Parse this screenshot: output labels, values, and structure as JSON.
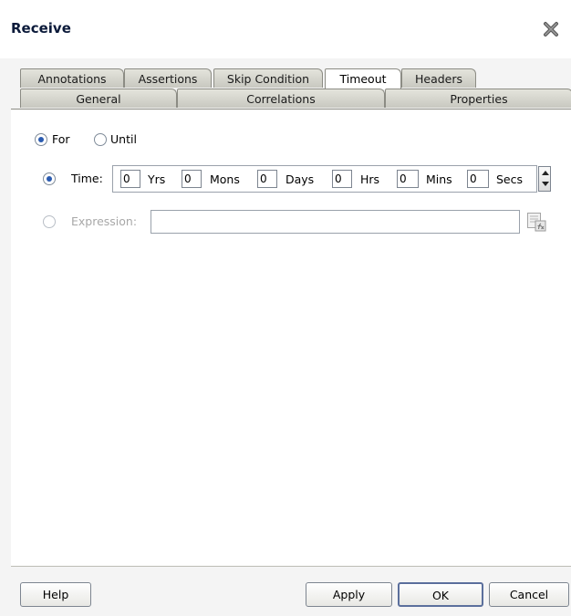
{
  "dialog": {
    "title": "Receive",
    "close_icon": "close-x-icon"
  },
  "tabs": {
    "back_row": [
      {
        "label": "Annotations"
      },
      {
        "label": "Assertions"
      },
      {
        "label": "Skip Condition"
      },
      {
        "label": "Timeout",
        "active": true
      },
      {
        "label": "Headers"
      }
    ],
    "front_row": [
      {
        "label": "General"
      },
      {
        "label": "Correlations"
      },
      {
        "label": "Properties"
      }
    ]
  },
  "timeout": {
    "mode": {
      "for_label": "For",
      "until_label": "Until",
      "selected": "For"
    },
    "time": {
      "label": "Time:",
      "selected": true,
      "fields": [
        {
          "value": "0",
          "unit": "Yrs"
        },
        {
          "value": "0",
          "unit": "Mons"
        },
        {
          "value": "0",
          "unit": "Days"
        },
        {
          "value": "0",
          "unit": "Hrs"
        },
        {
          "value": "0",
          "unit": "Mins"
        },
        {
          "value": "0",
          "unit": "Secs"
        }
      ]
    },
    "expression": {
      "label": "Expression:",
      "value": "",
      "enabled": false,
      "builder_icon": "expression-builder-icon"
    }
  },
  "buttons": {
    "help": "Help",
    "apply": "Apply",
    "ok": "OK",
    "cancel": "Cancel"
  },
  "colors": {
    "title": "#0b1a3a",
    "radio_selected": "#2a5bb0",
    "disabled_text": "#a8a8a8",
    "dialog_bg": "#f4f4f4"
  }
}
